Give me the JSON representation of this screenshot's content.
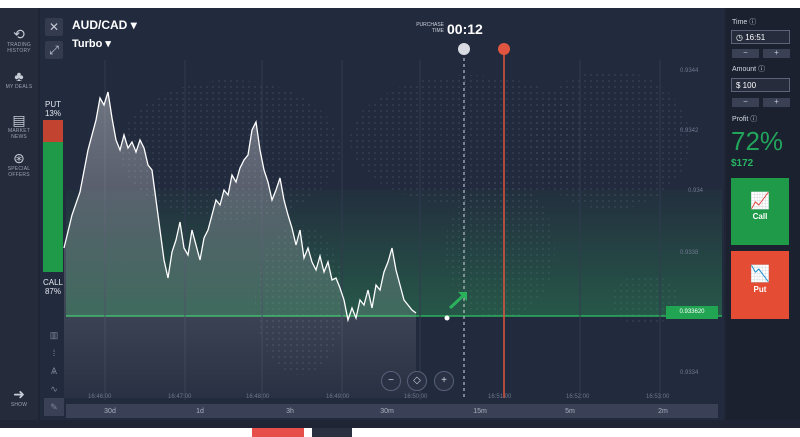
{
  "header": {
    "asset": "AUD/CAD",
    "mode": "Turbo",
    "purchase_time_label": "PURCHASE TIME",
    "purchase_time": "00:12"
  },
  "left_nav": [
    {
      "label": "TRADING HISTORY",
      "icon": "history-icon"
    },
    {
      "label": "MY DEALS",
      "icon": "deals-icon"
    },
    {
      "label": "MARKET NEWS",
      "icon": "news-icon"
    },
    {
      "label": "SPECIAL OFFERS",
      "icon": "offers-icon"
    },
    {
      "label": "SHOW",
      "icon": "arrow-right-icon"
    }
  ],
  "sentiment": {
    "put_label": "PUT",
    "put_pct": "13%",
    "call_label": "CALL",
    "call_pct": "87%"
  },
  "price_labels": [
    "0.9344",
    "0.9342",
    "0.934",
    "0.9338",
    "0.9334"
  ],
  "current_price": "0.933620",
  "time_labels": [
    "16:46:00",
    "16:47:00",
    "16:48:00",
    "16:49:00",
    "16:50:00",
    "16:51:00",
    "16:52:00",
    "16:53:00"
  ],
  "timeframes": [
    "30d",
    "1d",
    "3h",
    "30m",
    "15m",
    "5m",
    "2m"
  ],
  "panel": {
    "time_label": "Time",
    "time_value": "16:51",
    "amount_label": "Amount",
    "amount_value": "$ 100",
    "profit_label": "Profit",
    "profit_pct": "72%",
    "profit_amount": "$172",
    "call_label": "Call",
    "put_label": "Put",
    "minus": "−",
    "plus": "+"
  },
  "zoom_controls": [
    "−",
    "◇",
    "+"
  ],
  "colors": {
    "call": "#1f9a48",
    "put": "#e44d33",
    "accent_green": "#21a55a",
    "bg": "#1f2534"
  },
  "price_series": [
    [
      0.08,
      248
    ],
    [
      0.09,
      215
    ],
    [
      0.1,
      192
    ],
    [
      0.11,
      150
    ],
    [
      0.12,
      120
    ],
    [
      0.125,
      98
    ],
    [
      0.13,
      105
    ],
    [
      0.135,
      92
    ],
    [
      0.14,
      118
    ],
    [
      0.145,
      140
    ],
    [
      0.15,
      150
    ],
    [
      0.155,
      135
    ],
    [
      0.16,
      148
    ],
    [
      0.165,
      142
    ],
    [
      0.17,
      152
    ],
    [
      0.175,
      140
    ],
    [
      0.18,
      148
    ],
    [
      0.185,
      165
    ],
    [
      0.19,
      170
    ],
    [
      0.195,
      200
    ],
    [
      0.2,
      230
    ],
    [
      0.205,
      260
    ],
    [
      0.21,
      278
    ],
    [
      0.215,
      252
    ],
    [
      0.22,
      240
    ],
    [
      0.225,
      222
    ],
    [
      0.23,
      248
    ],
    [
      0.235,
      255
    ],
    [
      0.24,
      230
    ],
    [
      0.245,
      245
    ],
    [
      0.25,
      260
    ],
    [
      0.255,
      238
    ],
    [
      0.26,
      230
    ],
    [
      0.265,
      215
    ],
    [
      0.27,
      200
    ],
    [
      0.275,
      205
    ],
    [
      0.28,
      190
    ],
    [
      0.285,
      195
    ],
    [
      0.29,
      175
    ],
    [
      0.295,
      182
    ],
    [
      0.3,
      168
    ],
    [
      0.305,
      160
    ],
    [
      0.31,
      155
    ],
    [
      0.315,
      130
    ],
    [
      0.32,
      122
    ],
    [
      0.325,
      150
    ],
    [
      0.33,
      170
    ],
    [
      0.335,
      182
    ],
    [
      0.34,
      200
    ],
    [
      0.345,
      190
    ],
    [
      0.35,
      178
    ],
    [
      0.355,
      200
    ],
    [
      0.36,
      215
    ],
    [
      0.365,
      228
    ],
    [
      0.37,
      245
    ],
    [
      0.375,
      230
    ],
    [
      0.38,
      258
    ],
    [
      0.385,
      248
    ],
    [
      0.39,
      262
    ],
    [
      0.395,
      270
    ],
    [
      0.4,
      256
    ],
    [
      0.405,
      272
    ],
    [
      0.41,
      262
    ],
    [
      0.415,
      280
    ],
    [
      0.42,
      278
    ],
    [
      0.425,
      288
    ],
    [
      0.43,
      300
    ],
    [
      0.435,
      320
    ],
    [
      0.44,
      308
    ],
    [
      0.445,
      318
    ],
    [
      0.45,
      300
    ],
    [
      0.455,
      305
    ],
    [
      0.46,
      290
    ],
    [
      0.465,
      308
    ],
    [
      0.47,
      285
    ],
    [
      0.475,
      290
    ],
    [
      0.48,
      272
    ],
    [
      0.485,
      262
    ],
    [
      0.49,
      248
    ],
    [
      0.495,
      270
    ],
    [
      0.5,
      285
    ],
    [
      0.505,
      300
    ],
    [
      0.51,
      305
    ],
    [
      0.515,
      310
    ],
    [
      0.52,
      313
    ]
  ]
}
